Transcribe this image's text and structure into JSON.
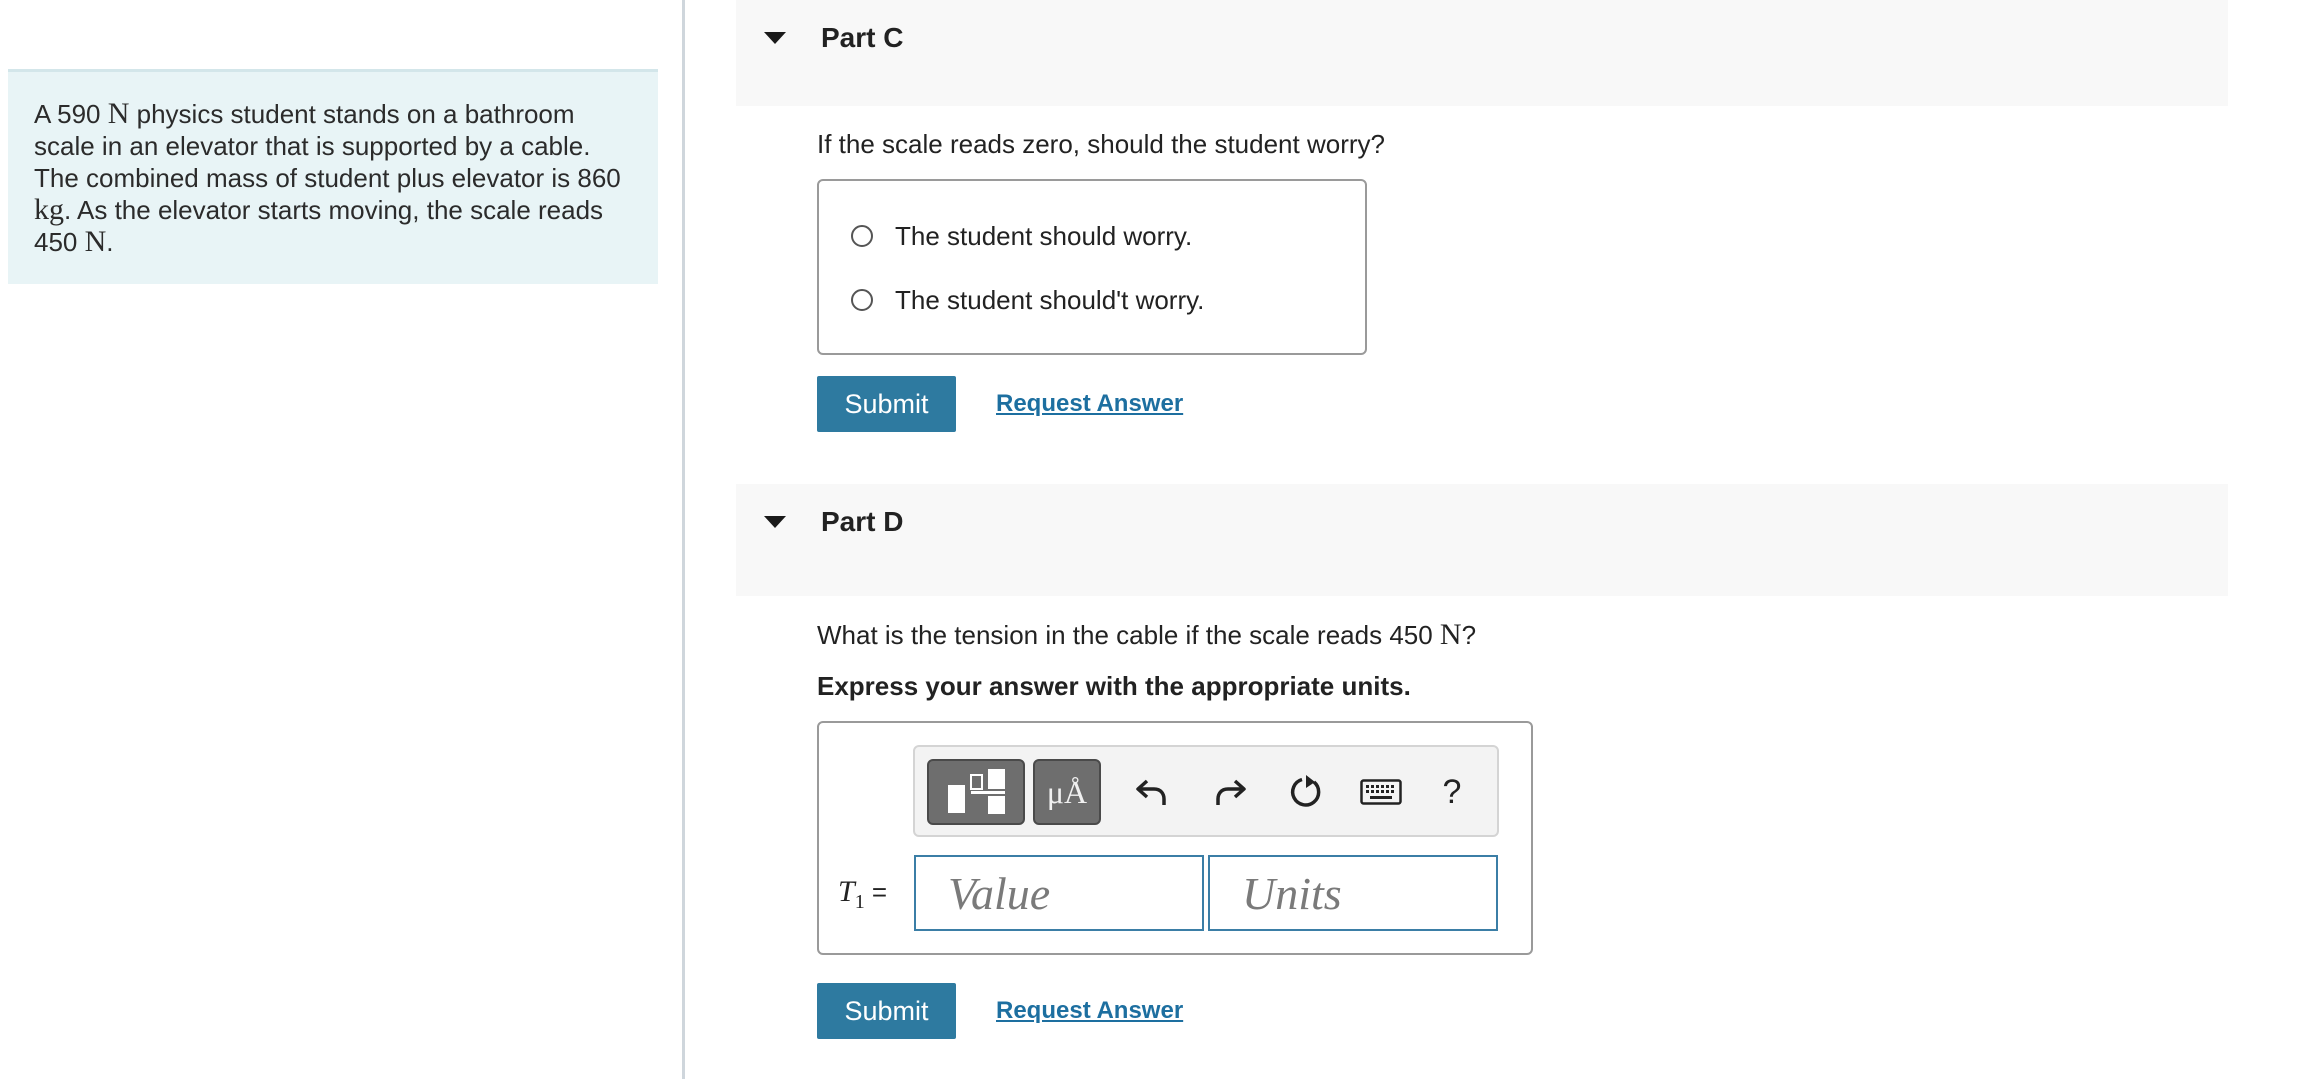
{
  "problem": {
    "seg1": "A 590 ",
    "unit_N": "N",
    "seg2": " physics student stands on a bathroom scale in an elevator that is supported by a cable. The combined mass of student plus elevator is 860 ",
    "unit_kg": "kg",
    "seg3": ". As the elevator starts moving, the scale reads 450 ",
    "unit_N2": "N",
    "seg4": "."
  },
  "part_c": {
    "title": "Part C",
    "question": "If the scale reads zero, should the student worry?",
    "choices": [
      "The student should worry.",
      "The student should't worry."
    ],
    "submit_label": "Submit",
    "request_label": "Request Answer"
  },
  "part_d": {
    "title": "Part D",
    "question_pre": "What is the tension in the cable if the scale reads 450 ",
    "question_unit": "N",
    "question_post": "?",
    "instruction": "Express your answer with the appropriate units.",
    "toolbar": {
      "templates_icon": "templates-icon",
      "symbols_label": "μÅ",
      "undo_icon": "undo-icon",
      "redo_icon": "redo-icon",
      "reset_icon": "reset-icon",
      "keyboard_icon": "keyboard-icon",
      "help_label": "?"
    },
    "answer_var": "T",
    "answer_sub": "1",
    "answer_eq": " =",
    "value_placeholder": "Value",
    "units_placeholder": "Units",
    "submit_label": "Submit",
    "request_label": "Request Answer"
  },
  "colors": {
    "accent": "#2e7aa0",
    "link": "#1d6fa0",
    "problem_bg": "#e8f4f6"
  }
}
